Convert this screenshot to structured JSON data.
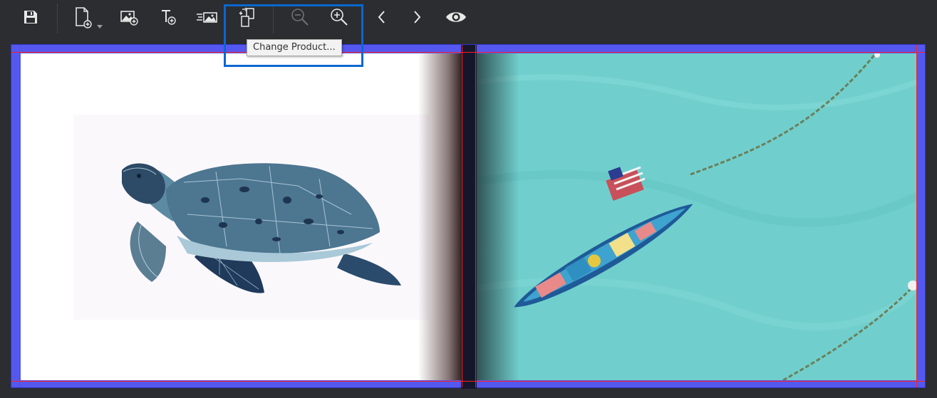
{
  "toolbar": {
    "buttons": [
      {
        "name": "save-button",
        "icon": "floppy-disk-icon"
      },
      {
        "name": "add-page-button",
        "icon": "add-page-icon"
      },
      {
        "name": "add-image-button",
        "icon": "add-image-icon"
      },
      {
        "name": "add-text-button",
        "icon": "add-text-icon"
      },
      {
        "name": "background-button",
        "icon": "background-image-icon"
      },
      {
        "name": "change-product-button",
        "icon": "change-product-icon"
      },
      {
        "name": "zoom-out-button",
        "icon": "zoom-out-icon"
      },
      {
        "name": "zoom-in-button",
        "icon": "zoom-in-icon"
      },
      {
        "name": "previous-page-button",
        "icon": "chevron-left-icon"
      },
      {
        "name": "next-page-button",
        "icon": "chevron-right-icon"
      },
      {
        "name": "preview-button",
        "icon": "eye-icon"
      }
    ]
  },
  "tooltip": {
    "text": "Change Product..."
  },
  "colors": {
    "background": "#2b2d30",
    "icon": "#e6e6e6",
    "icon_disabled": "#6e7176",
    "highlight": "#0a67d0",
    "bleed": "#5558ee",
    "guide": "#ff1e1e",
    "water": "#6fd0cf"
  },
  "canvas": {
    "left_page_image": "sea-turtle-illustration",
    "right_page_image": "boat-on-turquoise-water"
  }
}
